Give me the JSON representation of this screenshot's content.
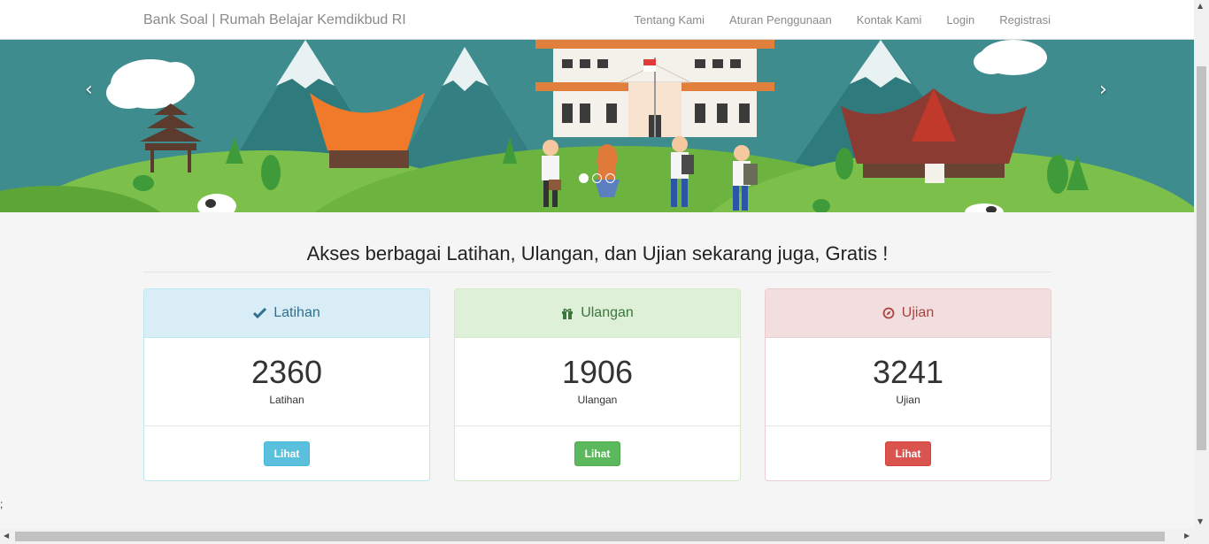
{
  "navbar": {
    "brand": "Bank Soal | Rumah Belajar Kemdikbud RI",
    "links": [
      "Tentang Kami",
      "Aturan Penggunaan",
      "Kontak Kami",
      "Login",
      "Registrasi"
    ]
  },
  "carousel": {
    "prev_glyph": "‹",
    "next_glyph": "›",
    "slide_count": 3,
    "active_index": 0
  },
  "headline": "Akses berbagai Latihan, Ulangan, dan Ujian sekarang juga, Gratis !",
  "panels": [
    {
      "title": "Latihan",
      "icon": "check-icon",
      "count": "2360",
      "label": "Latihan",
      "button": "Lihat",
      "color": "#5bc0de"
    },
    {
      "title": "Ulangan",
      "icon": "gift-icon",
      "count": "1906",
      "label": "Ulangan",
      "button": "Lihat",
      "color": "#5cb85c"
    },
    {
      "title": "Ujian",
      "icon": "compass-icon",
      "count": "3241",
      "label": "Ujian",
      "button": "Lihat",
      "color": "#d9534f"
    }
  ],
  "stray_text": ";"
}
